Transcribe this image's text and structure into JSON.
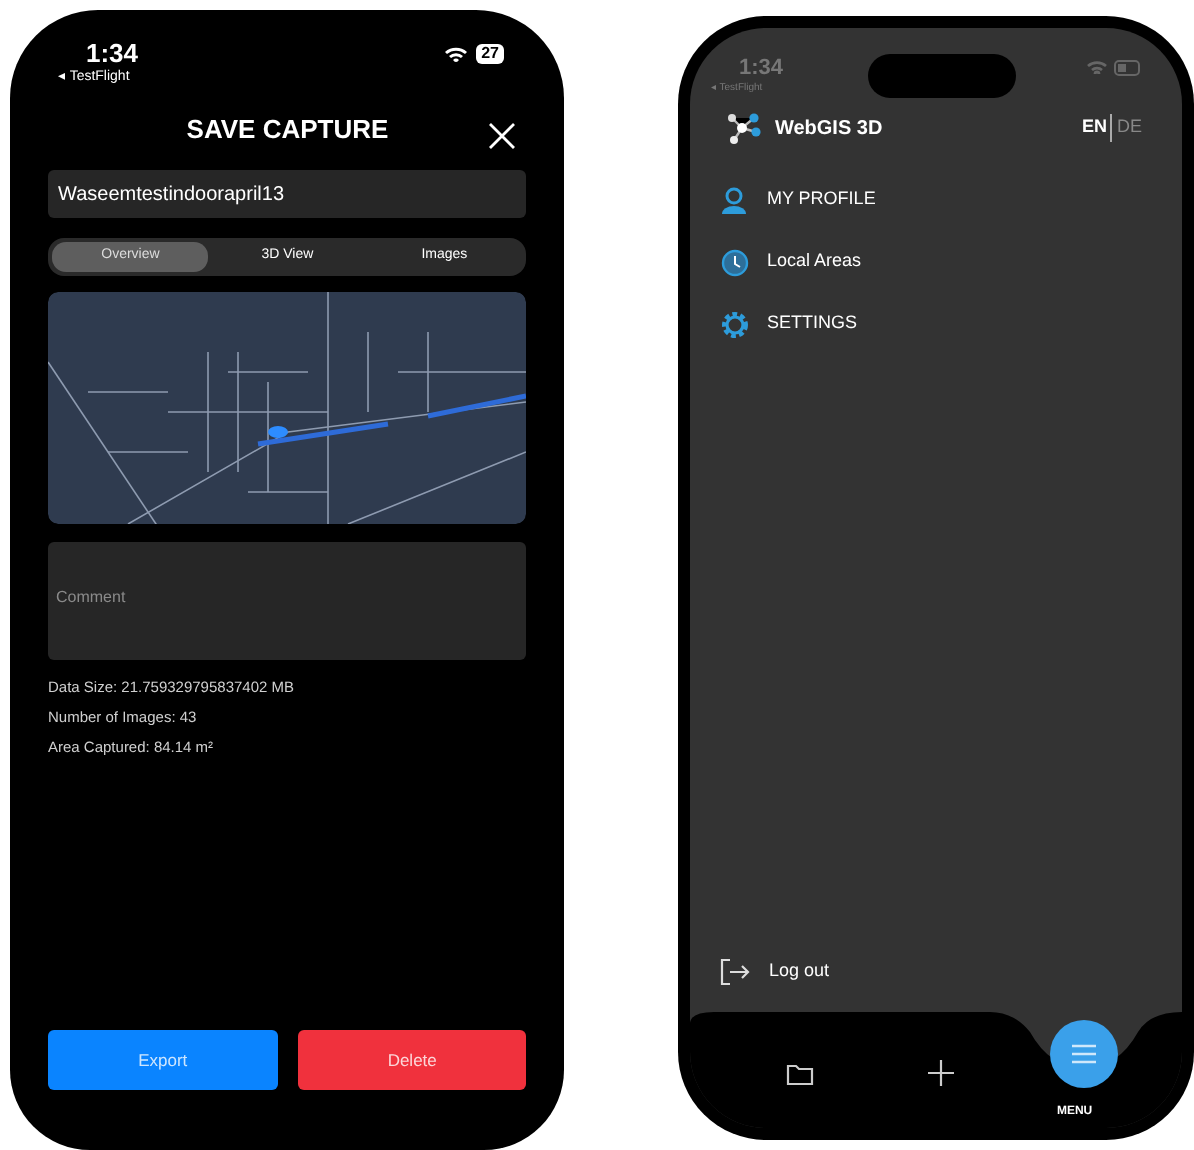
{
  "save_screen": {
    "status_bar": {
      "time": "1:34",
      "back_app": "◂ TestFlight",
      "battery": "27"
    },
    "title": "SAVE CAPTURE",
    "name_field": {
      "value": "Waseemtestindoorapril13"
    },
    "tabs": [
      {
        "label": "Overview",
        "selected": true
      },
      {
        "label": "3D View",
        "selected": false
      },
      {
        "label": "Images",
        "selected": false
      }
    ],
    "comment_field": {
      "placeholder": "Comment"
    },
    "info": [
      "Data Size: 21.759329795837402 MB",
      "Number of Images: 43",
      "Area Captured: 84.14 m²"
    ],
    "buttons": [
      {
        "label": "Export",
        "kind": "primary"
      },
      {
        "label": "Delete",
        "kind": "danger"
      }
    ]
  },
  "menu_screen": {
    "status_bar": {
      "time": "1:34",
      "back_app": "◂ TestFlight"
    },
    "app_name": "WebGIS 3D",
    "languages": [
      {
        "label": "EN",
        "selected": true
      },
      {
        "label": "DE",
        "selected": false
      }
    ],
    "items": [
      {
        "label": "MY PROFILE",
        "kind": "profile"
      },
      {
        "label": "Local Areas",
        "kind": "history"
      },
      {
        "label": "SETTINGS",
        "kind": "settings"
      }
    ],
    "logout": "Log out",
    "tab_bar": {
      "menu_label": "MENU"
    }
  }
}
